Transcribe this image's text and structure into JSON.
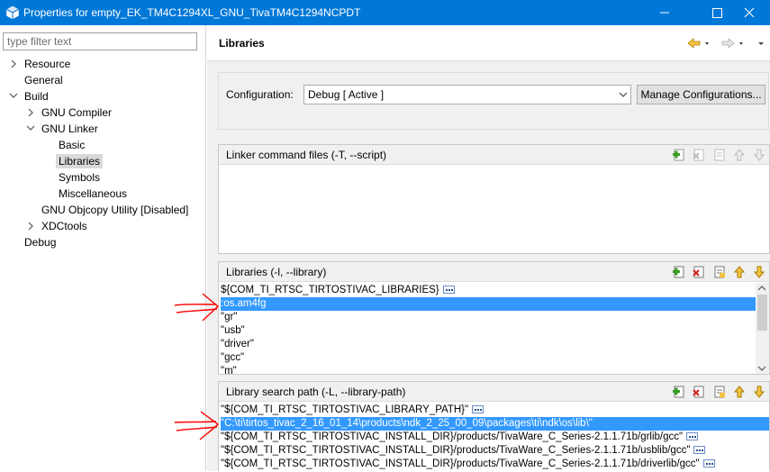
{
  "window": {
    "title": "Properties for empty_EK_TM4C1294XL_GNU_TivaTM4C1294NCPDT",
    "app_icon": "properties-window-icon",
    "titlebar_color": "#0078d7"
  },
  "left": {
    "filter_placeholder": "type filter text",
    "tree": [
      {
        "label": "Resource",
        "expander": "collapsed"
      },
      {
        "label": "General",
        "expander": "none"
      },
      {
        "label": "Build",
        "expander": "expanded"
      },
      {
        "label": "GNU Compiler",
        "expander": "collapsed"
      },
      {
        "label": "GNU Linker",
        "expander": "expanded"
      },
      {
        "label": "Basic",
        "expander": "none"
      },
      {
        "label": "Libraries",
        "expander": "none",
        "selected": true
      },
      {
        "label": "Symbols",
        "expander": "none"
      },
      {
        "label": "Miscellaneous",
        "expander": "none"
      },
      {
        "label": "GNU Objcopy Utility  [Disabled]",
        "expander": "none"
      },
      {
        "label": "XDCtools",
        "expander": "collapsed"
      },
      {
        "label": "Debug",
        "expander": "none"
      }
    ]
  },
  "right": {
    "page_title": "Libraries",
    "config": {
      "label": "Configuration:",
      "value": "Debug  [ Active ]",
      "manage_button": "Manage Configurations..."
    },
    "linker_cmd": {
      "title": "Linker command files (-T, --script)",
      "items": []
    },
    "libraries": {
      "title": "Libraries (-l, --library)",
      "items": [
        {
          "text": "${COM_TI_RTSC_TIRTOSTIVAC_LIBRARIES}",
          "more": true
        },
        {
          "text": ":os.am4fg",
          "selected": true
        },
        {
          "text": "\"gr\""
        },
        {
          "text": "\"usb\""
        },
        {
          "text": "\"driver\""
        },
        {
          "text": "\"gcc\""
        },
        {
          "text": "\"m\""
        }
      ]
    },
    "search_path": {
      "title": "Library search path (-L, --library-path)",
      "items": [
        {
          "text": "\"${COM_TI_RTSC_TIRTOSTIVAC_LIBRARY_PATH}\"",
          "more": true
        },
        {
          "text": "\"C:\\ti\\tirtos_tivac_2_16_01_14\\products\\ndk_2_25_00_09\\packages\\ti\\ndk\\os\\lib\\\"",
          "selected": true
        },
        {
          "text": "\"${COM_TI_RTSC_TIRTOSTIVAC_INSTALL_DIR}/products/TivaWare_C_Series-2.1.1.71b/grlib/gcc\"",
          "more": true
        },
        {
          "text": "\"${COM_TI_RTSC_TIRTOSTIVAC_INSTALL_DIR}/products/TivaWare_C_Series-2.1.1.71b/usblib/gcc\"",
          "more": true
        },
        {
          "text": "\"${COM_TI_RTSC_TIRTOSTIVAC_INSTALL_DIR}/products/TivaWare_C_Series-2.1.1.71b/driverlib/gcc\"",
          "more": true
        }
      ]
    },
    "toolbar_icons": [
      "add-icon",
      "delete-icon",
      "edit-icon",
      "move-up-icon",
      "move-down-icon"
    ]
  },
  "colors": {
    "selection": "#3399ff",
    "tree_selection": "#d9d9d9",
    "annotation_arrow": "#ff0000"
  }
}
